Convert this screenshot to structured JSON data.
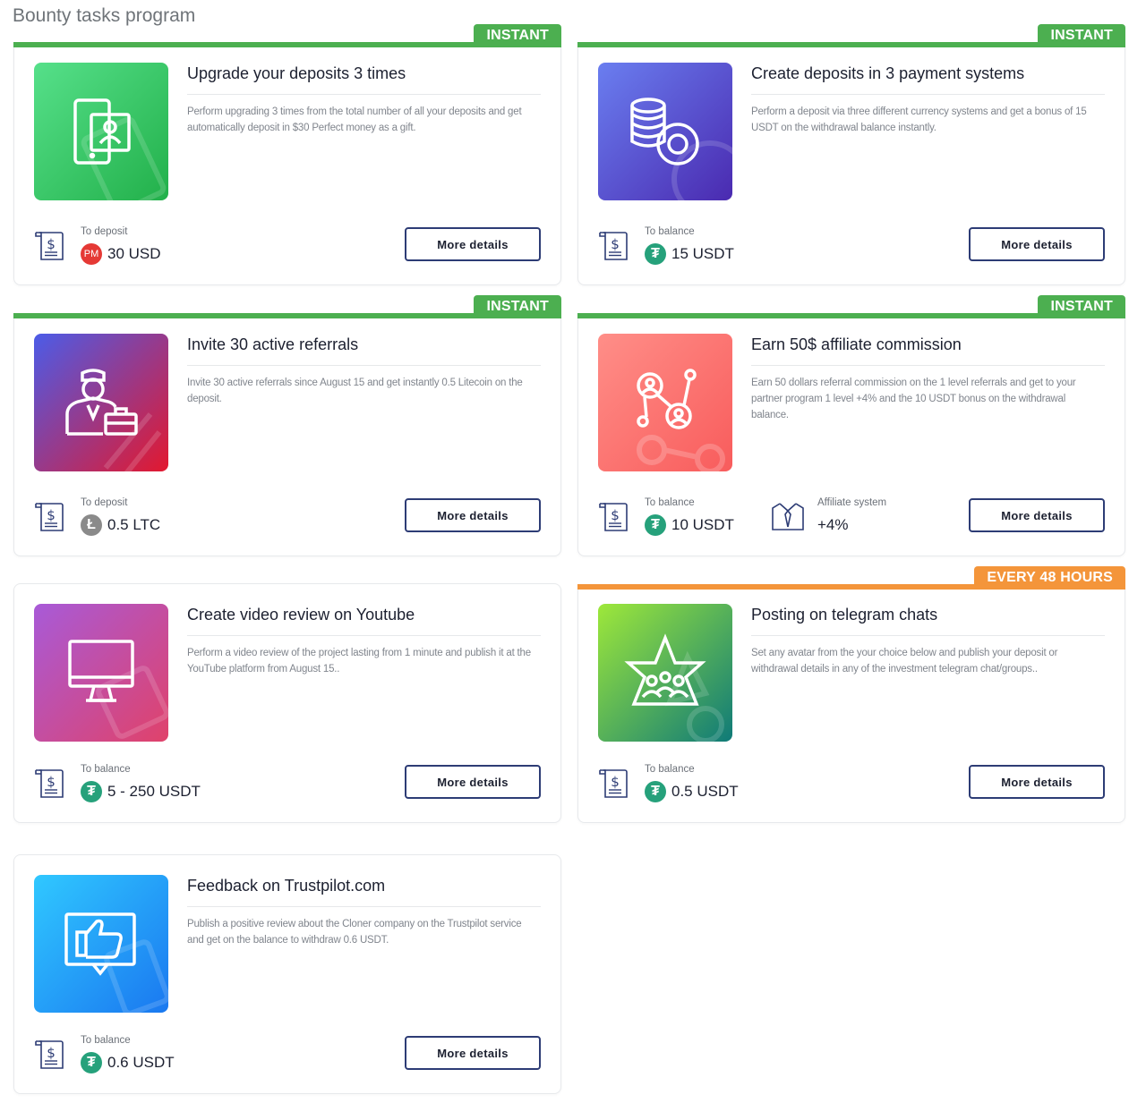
{
  "page_title": "Bounty tasks program",
  "more_label": "More details",
  "cards": [
    {
      "badge": "INSTANT",
      "title": "Upgrade your deposits 3 times",
      "desc": "Perform upgrading 3 times from the total number of all your deposits and get automatically deposit in $30 Perfect money as a gift.",
      "reward_label": "To deposit",
      "coin_text": "PM",
      "reward_value": "30 USD"
    },
    {
      "badge": "INSTANT",
      "title": "Create deposits in 3 payment systems",
      "desc": "Perform a deposit via three different currency systems and get a bonus of 15 USDT on the withdrawal balance instantly.",
      "reward_label": "To balance",
      "coin_text": "₮",
      "reward_value": "15 USDT"
    },
    {
      "badge": "INSTANT",
      "title": "Invite 30 active referrals",
      "desc": "Invite 30 active referrals since August 15 and get instantly 0.5 Litecoin on the deposit.",
      "reward_label": "To deposit",
      "coin_text": "Ł",
      "reward_value": "0.5 LTC"
    },
    {
      "badge": "INSTANT",
      "title": "Earn 50$ affiliate commission",
      "desc": "Earn 50 dollars referral commission on the 1 level referrals and get to your partner program 1 level +4% and the 10 USDT bonus on the withdrawal balance.",
      "reward_label": "To balance",
      "coin_text": "₮",
      "reward_value": "10 USDT",
      "affiliate_label": "Affiliate system",
      "affiliate_value": "+4%"
    },
    {
      "badge": "",
      "title": "Create video review on Youtube",
      "desc": "Perform a video review of the project lasting from 1 minute and publish it at the YouTube platform from August 15..",
      "reward_label": "To balance",
      "coin_text": "₮",
      "reward_value": "5 - 250 USDT"
    },
    {
      "badge": "EVERY 48 HOURS",
      "title": "Posting on telegram chats",
      "desc": "Set any avatar from the your choice below and publish your deposit or withdrawal details in any of the investment telegram chat/groups..",
      "reward_label": "To balance",
      "coin_text": "₮",
      "reward_value": "0.5 USDT"
    },
    {
      "badge": "",
      "title": "Feedback on Trustpilot.com",
      "desc": "Publish a positive review about the Cloner company on the Trustpilot service and get on the balance to withdraw 0.6 USDT.",
      "reward_label": "To balance",
      "coin_text": "₮",
      "reward_value": "0.6 USDT"
    }
  ],
  "colors": {
    "instant": "#4caf50",
    "every48": "#f4953a",
    "button_border": "#2d3c75",
    "usdt": "#26a17b",
    "pm": "#e53935",
    "ltc": "#8a8a8a"
  },
  "icons": [
    "phone-user-icon",
    "coin-stack-icon",
    "manager-briefcase-icon",
    "network-people-icon",
    "monitor-icon",
    "star-group-icon",
    "thumbs-up-icon",
    "receipt-dollar-icon",
    "shirt-tie-icon"
  ]
}
